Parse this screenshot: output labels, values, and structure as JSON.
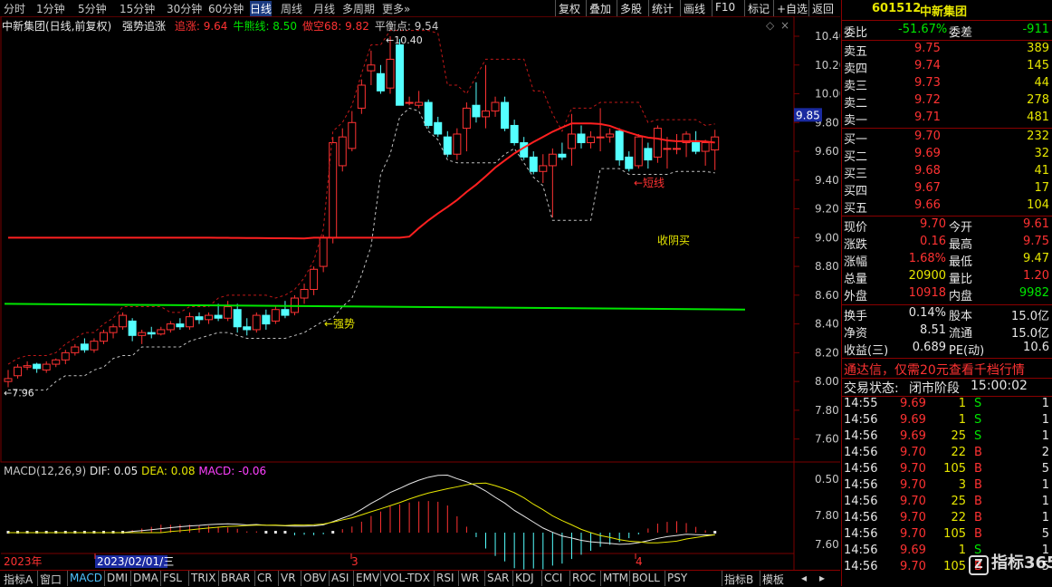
{
  "periods": [
    "分时",
    "1分钟",
    "5分钟",
    "15分钟",
    "30分钟",
    "60分钟",
    "日线",
    "周线",
    "月线",
    "多周期",
    "更多»"
  ],
  "active_period": "日线",
  "toolbar": [
    "复权",
    "叠加",
    "多股",
    "统计",
    "画线",
    "F10",
    "标记",
    "+自选",
    "返回"
  ],
  "chart_title": {
    "stock": "中新集团(日线,前复权)",
    "indicator": "强势追涨",
    "items": [
      {
        "label": "追涨:",
        "value": "9.64",
        "color": "#ff3232"
      },
      {
        "label": "牛熊线:",
        "value": "8.50",
        "color": "#00e600"
      },
      {
        "label": "做空68:",
        "value": "9.82",
        "color": "#ff3232"
      },
      {
        "label": "平衡点:",
        "value": "9.54",
        "color": "#c8c8c8"
      }
    ]
  },
  "price_axis": [
    "10.40",
    "10.20",
    "10.00",
    "9.80",
    "9.60",
    "9.40",
    "9.20",
    "9.00",
    "8.80",
    "8.60",
    "8.40",
    "8.20",
    "8.00",
    "7.80",
    "7.60"
  ],
  "price_marker": "9.85",
  "annotations": {
    "high": "10.40",
    "low": "7.96",
    "short_line": "←短线",
    "close_buy": "收阴买",
    "strong": "←强势"
  },
  "macd": {
    "title": "MACD(12,26,9)",
    "dif": "DIF: 0.05",
    "dea": "DEA: 0.08",
    "macd": "MACD: -0.06",
    "axis": [
      "0.50",
      "7.80",
      "7.60"
    ]
  },
  "date_axis": {
    "year": "2023年",
    "cursor_date": "2023/02/01/三",
    "month_3": "3",
    "month_4": "4"
  },
  "bottom_tabs": [
    "指标A",
    "窗口",
    "MACD",
    "DMI",
    "DMA",
    "FSL",
    "TRIX",
    "BRAR",
    "CR",
    "VR",
    "OBV",
    "ASI",
    "EMV",
    "VOL-TDX",
    "RSI",
    "WR",
    "SAR",
    "KDJ",
    "CCI",
    "ROC",
    "MTM",
    "BOLL",
    "PSY",
    "指标B",
    "模板"
  ],
  "active_tab": "MACD",
  "quote": {
    "code": "601512",
    "name": "中新集团",
    "weibi_label": "委比",
    "weibi": "-51.67%",
    "weicha_label": "委差",
    "weicha": "-911",
    "asks": [
      {
        "label": "卖五",
        "price": "9.75",
        "vol": "389"
      },
      {
        "label": "卖四",
        "price": "9.74",
        "vol": "145"
      },
      {
        "label": "卖三",
        "price": "9.73",
        "vol": "44"
      },
      {
        "label": "卖二",
        "price": "9.72",
        "vol": "278"
      },
      {
        "label": "卖一",
        "price": "9.71",
        "vol": "481"
      }
    ],
    "bids": [
      {
        "label": "买一",
        "price": "9.70",
        "vol": "232"
      },
      {
        "label": "买二",
        "price": "9.69",
        "vol": "32"
      },
      {
        "label": "买三",
        "price": "9.68",
        "vol": "41"
      },
      {
        "label": "买四",
        "price": "9.67",
        "vol": "17"
      },
      {
        "label": "买五",
        "price": "9.66",
        "vol": "104"
      }
    ],
    "stats": [
      {
        "l1": "现价",
        "v1": "9.70",
        "c1": "#ff3232",
        "l2": "今开",
        "v2": "9.61",
        "c2": "#ff3232"
      },
      {
        "l1": "涨跌",
        "v1": "0.16",
        "c1": "#ff3232",
        "l2": "最高",
        "v2": "9.75",
        "c2": "#ff3232"
      },
      {
        "l1": "涨幅",
        "v1": "1.68%",
        "c1": "#ff3232",
        "l2": "最低",
        "v2": "9.47",
        "c2": "#e6e600"
      },
      {
        "l1": "总量",
        "v1": "20900",
        "c1": "#e6e600",
        "l2": "量比",
        "v2": "1.20",
        "c2": "#ff3232"
      },
      {
        "l1": "外盘",
        "v1": "10918",
        "c1": "#ff3232",
        "l2": "内盘",
        "v2": "9982",
        "c2": "#00e600"
      }
    ],
    "stats2": [
      {
        "l1": "换手",
        "v1": "0.14%",
        "l2": "股本",
        "v2": "15.0亿"
      },
      {
        "l1": "净资",
        "v1": "8.51",
        "l2": "流通",
        "v2": "15.0亿"
      },
      {
        "l1": "收益(三)",
        "v1": "0.689",
        "l2": "PE(动)",
        "v2": "10.6"
      }
    ],
    "ad": "通达信，仅需20元查看千档行情",
    "status_label": "交易状态:",
    "status": "闭市阶段",
    "status_time": "15:00:02",
    "ticks": [
      {
        "t": "14:55",
        "p": "9.69",
        "v": "1",
        "s": "S",
        "n": "1"
      },
      {
        "t": "14:56",
        "p": "9.69",
        "v": "1",
        "s": "S",
        "n": "1"
      },
      {
        "t": "14:56",
        "p": "9.69",
        "v": "25",
        "s": "S",
        "n": "1"
      },
      {
        "t": "14:56",
        "p": "9.70",
        "v": "22",
        "s": "B",
        "n": "2"
      },
      {
        "t": "14:56",
        "p": "9.70",
        "v": "105",
        "s": "B",
        "n": "5"
      },
      {
        "t": "14:56",
        "p": "9.70",
        "v": "3",
        "s": "B",
        "n": "1"
      },
      {
        "t": "14:56",
        "p": "9.70",
        "v": "25",
        "s": "B",
        "n": "1"
      },
      {
        "t": "14:56",
        "p": "9.70",
        "v": "22",
        "s": "B",
        "n": "1"
      },
      {
        "t": "14:56",
        "p": "9.70",
        "v": "105",
        "s": "B",
        "n": "5"
      },
      {
        "t": "14:56",
        "p": "9.69",
        "v": "1",
        "s": "S",
        "n": "1"
      },
      {
        "t": "14:56",
        "p": "9.70",
        "v": "105",
        "s": "B",
        "n": "5"
      }
    ],
    "watermark": "指标365"
  },
  "colors": {
    "up": "#ff3232",
    "down": "#54ffff",
    "ma_red": "#ff2020",
    "ma_green": "#00e600",
    "panel_border": "#8a0000"
  },
  "chart_data": {
    "type": "candlestick",
    "candles": [
      [
        8.0,
        8.08,
        7.96,
        8.02
      ],
      [
        8.04,
        8.12,
        8.02,
        8.1
      ],
      [
        8.1,
        8.14,
        8.08,
        8.11
      ],
      [
        8.12,
        8.13,
        8.06,
        8.09
      ],
      [
        8.08,
        8.14,
        8.06,
        8.12
      ],
      [
        8.12,
        8.16,
        8.1,
        8.15
      ],
      [
        8.15,
        8.22,
        8.12,
        8.2
      ],
      [
        8.2,
        8.26,
        8.18,
        8.24
      ],
      [
        8.26,
        8.3,
        8.2,
        8.22
      ],
      [
        8.22,
        8.3,
        8.2,
        8.28
      ],
      [
        8.28,
        8.36,
        8.26,
        8.34
      ],
      [
        8.34,
        8.4,
        8.3,
        8.38
      ],
      [
        8.38,
        8.48,
        8.36,
        8.46
      ],
      [
        8.42,
        8.44,
        8.28,
        8.32
      ],
      [
        8.32,
        8.36,
        8.26,
        8.34
      ],
      [
        8.34,
        8.38,
        8.3,
        8.33
      ],
      [
        8.33,
        8.38,
        8.32,
        8.36
      ],
      [
        8.36,
        8.42,
        8.34,
        8.4
      ],
      [
        8.4,
        8.44,
        8.36,
        8.38
      ],
      [
        8.38,
        8.48,
        8.36,
        8.45
      ],
      [
        8.45,
        8.48,
        8.4,
        8.43
      ],
      [
        8.43,
        8.48,
        8.4,
        8.46
      ],
      [
        8.46,
        8.54,
        8.42,
        8.44
      ],
      [
        8.44,
        8.56,
        8.42,
        8.52
      ],
      [
        8.5,
        8.54,
        8.34,
        8.38
      ],
      [
        8.38,
        8.44,
        8.32,
        8.36
      ],
      [
        8.36,
        8.48,
        8.34,
        8.46
      ],
      [
        8.46,
        8.5,
        8.36,
        8.4
      ],
      [
        8.42,
        8.52,
        8.4,
        8.5
      ],
      [
        8.5,
        8.56,
        8.44,
        8.46
      ],
      [
        8.48,
        8.6,
        8.46,
        8.58
      ],
      [
        8.58,
        8.68,
        8.54,
        8.64
      ],
      [
        8.64,
        8.8,
        8.6,
        8.78
      ],
      [
        8.8,
        9.02,
        8.76,
        9.0
      ],
      [
        9.0,
        9.7,
        8.96,
        9.66
      ],
      [
        9.5,
        9.76,
        9.46,
        9.7
      ],
      [
        9.62,
        9.88,
        9.6,
        9.8
      ],
      [
        9.9,
        10.1,
        9.86,
        10.06
      ],
      [
        10.16,
        10.3,
        10.06,
        10.2
      ],
      [
        10.14,
        10.2,
        10.0,
        10.02
      ],
      [
        10.04,
        10.4,
        10.0,
        10.24
      ],
      [
        10.34,
        10.38,
        9.98,
        9.92
      ],
      [
        9.94,
        9.98,
        9.92,
        9.94
      ],
      [
        9.92,
        10.02,
        9.9,
        9.94
      ],
      [
        9.94,
        9.96,
        9.76,
        9.78
      ],
      [
        9.8,
        9.84,
        9.7,
        9.72
      ],
      [
        9.7,
        9.74,
        9.56,
        9.58
      ],
      [
        9.58,
        9.76,
        9.54,
        9.72
      ],
      [
        9.76,
        9.94,
        9.6,
        9.9
      ],
      [
        9.92,
        10.08,
        9.8,
        9.84
      ],
      [
        9.84,
        10.2,
        9.76,
        9.88
      ],
      [
        9.88,
        9.98,
        9.84,
        9.94
      ],
      [
        9.94,
        9.98,
        9.74,
        9.76
      ],
      [
        9.78,
        9.82,
        9.64,
        9.66
      ],
      [
        9.66,
        9.7,
        9.54,
        9.56
      ],
      [
        9.56,
        9.6,
        9.44,
        9.46
      ],
      [
        9.46,
        9.58,
        9.38,
        9.5
      ],
      [
        9.5,
        9.62,
        9.14,
        9.58
      ],
      [
        9.58,
        9.66,
        9.54,
        9.56
      ],
      [
        9.62,
        9.86,
        9.5,
        9.72
      ],
      [
        9.72,
        9.78,
        9.62,
        9.66
      ],
      [
        9.66,
        9.74,
        9.62,
        9.7
      ],
      [
        9.7,
        9.9,
        9.6,
        9.7
      ],
      [
        9.7,
        9.76,
        9.66,
        9.72
      ],
      [
        9.74,
        9.76,
        9.5,
        9.54
      ],
      [
        9.56,
        9.6,
        9.46,
        9.48
      ],
      [
        9.5,
        9.72,
        9.48,
        9.7
      ],
      [
        9.62,
        9.66,
        9.48,
        9.54
      ],
      [
        9.56,
        9.78,
        9.52,
        9.76
      ],
      [
        9.62,
        9.7,
        9.48,
        9.62
      ],
      [
        9.62,
        9.72,
        9.58,
        9.62
      ],
      [
        9.66,
        9.74,
        9.56,
        9.72
      ],
      [
        9.66,
        9.74,
        9.58,
        9.6
      ],
      [
        9.6,
        9.68,
        9.5,
        9.66
      ],
      [
        9.61,
        9.75,
        9.47,
        9.7
      ]
    ],
    "ma_red_level_start": 9.0,
    "bull_bear_line": 8.5,
    "ylim": [
      7.52,
      10.48
    ]
  }
}
